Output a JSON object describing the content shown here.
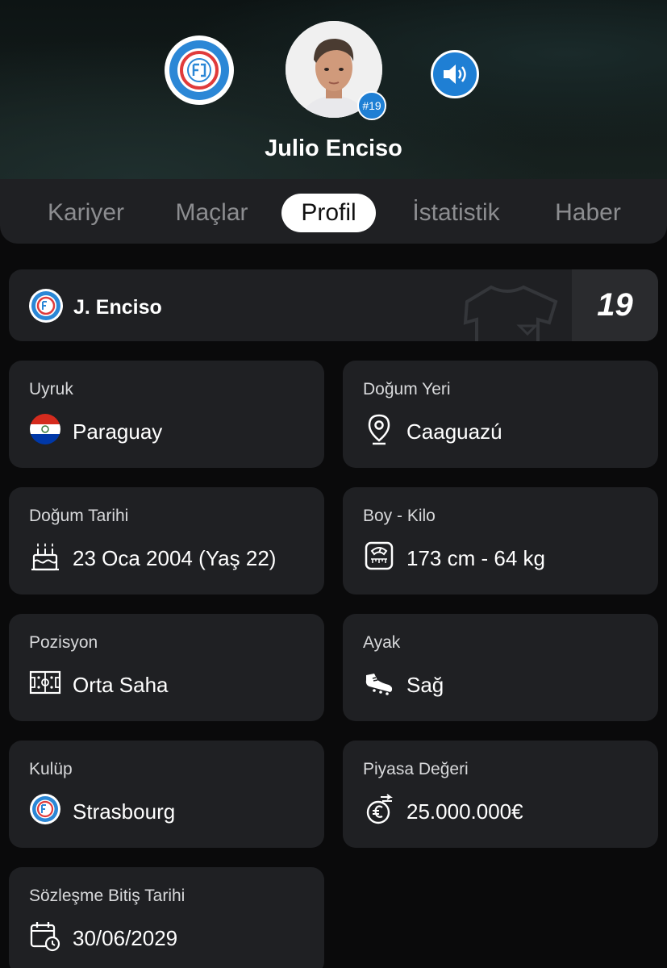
{
  "header": {
    "player_name": "Julio Enciso",
    "jersey_badge": "#19",
    "club_logo_icon": "rcs-strasbourg-logo",
    "sound_icon": "speaker-icon"
  },
  "tabs": [
    {
      "label": "Kariyer",
      "active": false
    },
    {
      "label": "Maçlar",
      "active": false
    },
    {
      "label": "Profil",
      "active": true
    },
    {
      "label": "İstatistik",
      "active": false
    },
    {
      "label": "Haber",
      "active": false
    }
  ],
  "name_card": {
    "short_name": "J. Enciso",
    "number": "19"
  },
  "info": {
    "nationality": {
      "label": "Uyruk",
      "value": "Paraguay",
      "icon": "paraguay-flag-icon"
    },
    "birthplace": {
      "label": "Doğum Yeri",
      "value": "Caaguazú",
      "icon": "location-pin-icon"
    },
    "birthdate": {
      "label": "Doğum Tarihi",
      "value": "23 Oca 2004 (Yaş 22)",
      "icon": "birthday-cake-icon"
    },
    "height_weight": {
      "label": "Boy - Kilo",
      "value": "173 cm - 64 kg",
      "icon": "scale-icon"
    },
    "position": {
      "label": "Pozisyon",
      "value": "Orta Saha",
      "icon": "pitch-icon"
    },
    "foot": {
      "label": "Ayak",
      "value": "Sağ",
      "icon": "boot-icon"
    },
    "club": {
      "label": "Kulüp",
      "value": "Strasbourg",
      "icon": "club-logo-icon"
    },
    "market_value": {
      "label": "Piyasa Değeri",
      "value": "25.000.000€",
      "icon": "euro-coin-icon"
    },
    "contract_end": {
      "label": "Sözleşme Bitiş Tarihi",
      "value": "30/06/2029",
      "icon": "calendar-clock-icon"
    }
  },
  "colors": {
    "accent": "#1f7fd4",
    "card": "#1f2023",
    "background": "#0a0a0b"
  }
}
